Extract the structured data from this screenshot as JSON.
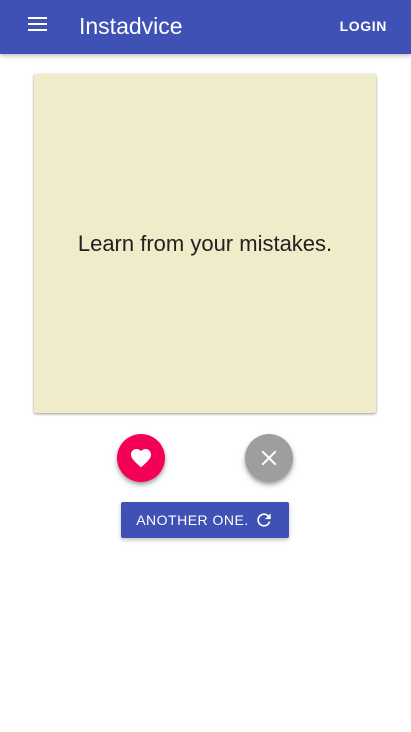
{
  "appbar": {
    "title": "Instadvice",
    "login_label": "LOGIN",
    "menu_icon": "menu-icon",
    "color": "#3f51b5"
  },
  "card": {
    "advice": "Learn from your mistakes.",
    "background": "#f0ebc8"
  },
  "actions": {
    "like_icon": "heart-icon",
    "like_color": "#f50057",
    "dismiss_icon": "close-icon",
    "dismiss_color": "#9e9e9e",
    "another_label": "ANOTHER ONE.",
    "another_icon": "refresh-icon"
  }
}
